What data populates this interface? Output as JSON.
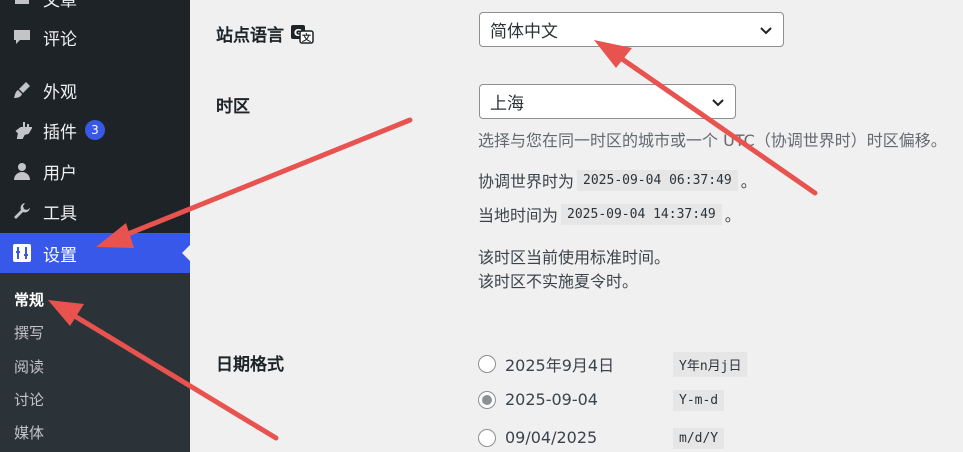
{
  "sidebar": {
    "items": [
      {
        "label": "文章",
        "icon": "media-icon"
      },
      {
        "label": "评论",
        "icon": "comment-icon"
      },
      {
        "label": "外观",
        "icon": "brush-icon"
      },
      {
        "label": "插件",
        "icon": "plugin-icon",
        "badge": "3"
      },
      {
        "label": "用户",
        "icon": "user-icon"
      },
      {
        "label": "工具",
        "icon": "wrench-icon"
      },
      {
        "label": "设置",
        "icon": "settings-icon"
      }
    ],
    "submenu": [
      "常规",
      "撰写",
      "阅读",
      "讨论",
      "媒体"
    ]
  },
  "site_language": {
    "label": "站点语言",
    "value": "简体中文"
  },
  "timezone": {
    "label": "时区",
    "value": "上海",
    "description": "选择与您在同一时区的城市或一个 UTC（协调世界时）时区偏移。",
    "utc_prefix": "协调世界时为",
    "utc_time": "2025-09-04 06:37:49",
    "utc_suffix": "。",
    "local_prefix": "当地时间为",
    "local_time": "2025-09-04 14:37:49",
    "local_suffix": "。",
    "note1": "该时区当前使用标准时间。",
    "note2": "该时区不实施夏令时。"
  },
  "date_format": {
    "label": "日期格式",
    "options": [
      {
        "display": "2025年9月4日",
        "code": "Y年n月j日",
        "selected": false
      },
      {
        "display": "2025-09-04",
        "code": "Y-m-d",
        "selected": true
      },
      {
        "display": "09/04/2025",
        "code": "m/d/Y",
        "selected": false
      }
    ]
  },
  "colors": {
    "sidebar_bg": "#1d2327",
    "active_bg": "#3858e9",
    "annotation_arrow": "#e8534f"
  }
}
